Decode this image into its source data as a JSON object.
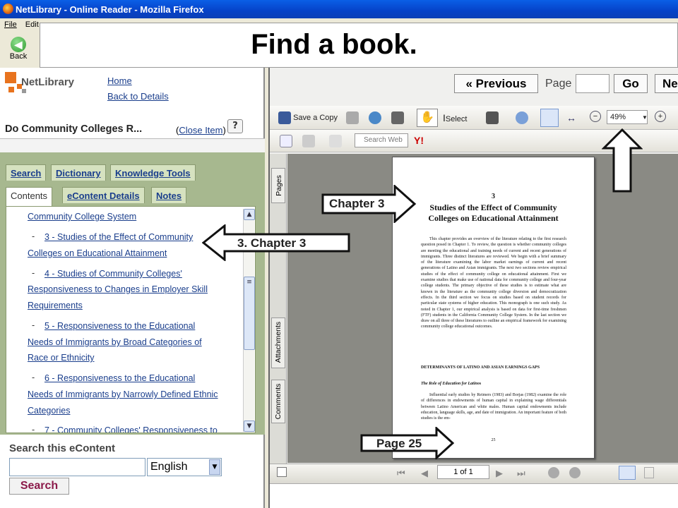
{
  "window": {
    "title": "NetLibrary - Online Reader - Mozilla Firefox"
  },
  "menu": [
    "File",
    "Edit"
  ],
  "browser": {
    "back_label": "Back"
  },
  "banner": {
    "text": "Find a book."
  },
  "left": {
    "logo_text": "NetLibrary",
    "home_link": "Home",
    "back_details_link": "Back to Details",
    "item_title": "Do Community Colleges R...",
    "close_open": "(",
    "close_link": "Close Item",
    "close_end": ")",
    "help_icon": "?",
    "tabs_row1": [
      "Search",
      "Dictionary",
      "Knowledge Tools"
    ],
    "tabs_row2": [
      "Contents",
      "eContent Details",
      "Notes"
    ],
    "toc": [
      "Community College System",
      "3 - Studies of the Effect of Community",
      "Colleges on Educational Attainment",
      "4 - Studies of Community Colleges'",
      "Responsiveness to Changes in Employer Skill",
      "Requirements",
      "5 - Responsiveness to the Educational",
      "Needs of Immigrants by Broad Categories of",
      "Race or Ethnicity",
      "6 - Responsiveness to the Educational",
      "Needs of Immigrants by Narrowly Defined Ethnic",
      "Categories",
      "7 - Community Colleges' Responsiveness to"
    ],
    "toc_dash": "-",
    "search_label": "Search this eContent",
    "search_value": "",
    "lang": "English",
    "search_button": "Search"
  },
  "reader": {
    "prev": "« Previous",
    "page_label": "Page",
    "page_value": "",
    "go": "Go",
    "next": "Ne",
    "save_copy": "Save a Copy",
    "select": "Select",
    "zoom": "49%",
    "search_web": "Search Web",
    "side_tabs": [
      "Pages",
      "Attachments",
      "Comments"
    ],
    "page_of": "1 of 1"
  },
  "doc": {
    "chapter_num": "3",
    "title1": "Studies of the Effect of Community",
    "title2": "Colleges on Educational Attainment",
    "para1": "This chapter provides an overview of the literature relating to the first research question posed in Chapter 1. To review, the question is whether community colleges are meeting the educational and training needs of current and recent generations of immigrants. Three distinct literatures are reviewed. We begin with a brief summary of the literature examining the labor market earnings of current and recent generations of Latino and Asian immigrants. The next two sections review empirical studies of the effect of community college on educational attainment. First we examine studies that make use of national data for community college and four-year college students. The primary objective of these studies is to estimate what are known in the literature as the community college diversion and democratization effects. In the third section we focus on studies based on student records for particular state systems of higher education. This monograph is one such study. As noted in Chapter 1, our empirical analysis is based on data for first-time freshmen (FTF) students in the California Community College System. In the last section we draw on all three of these literatures to outline an empirical framework for examining community college educational outcomes.",
    "heading1": "DETERMINANTS OF LATINO AND ASIAN EARNINGS GAPS",
    "heading2": "The Role of Education for Latinos",
    "para2": "Influential early studies by Reimers (1983) and Borjas (1982) examine the role of differences in endowments of human capital in explaining wage differentials between Latino American and white males. Human capital endowments include education, language skills, age, and date of immigration. An important feature of both studies is the em-",
    "page_num": "25"
  },
  "callouts": {
    "chapter3": "Chapter 3",
    "toc_chapter3": "3. Chapter 3",
    "page25": "Page 25"
  },
  "colors": {
    "banner_bg": "#ffffff",
    "tab_green": "#a7b88f",
    "link_blue": "#1a3e8c",
    "search_red": "#8b1a4a"
  }
}
